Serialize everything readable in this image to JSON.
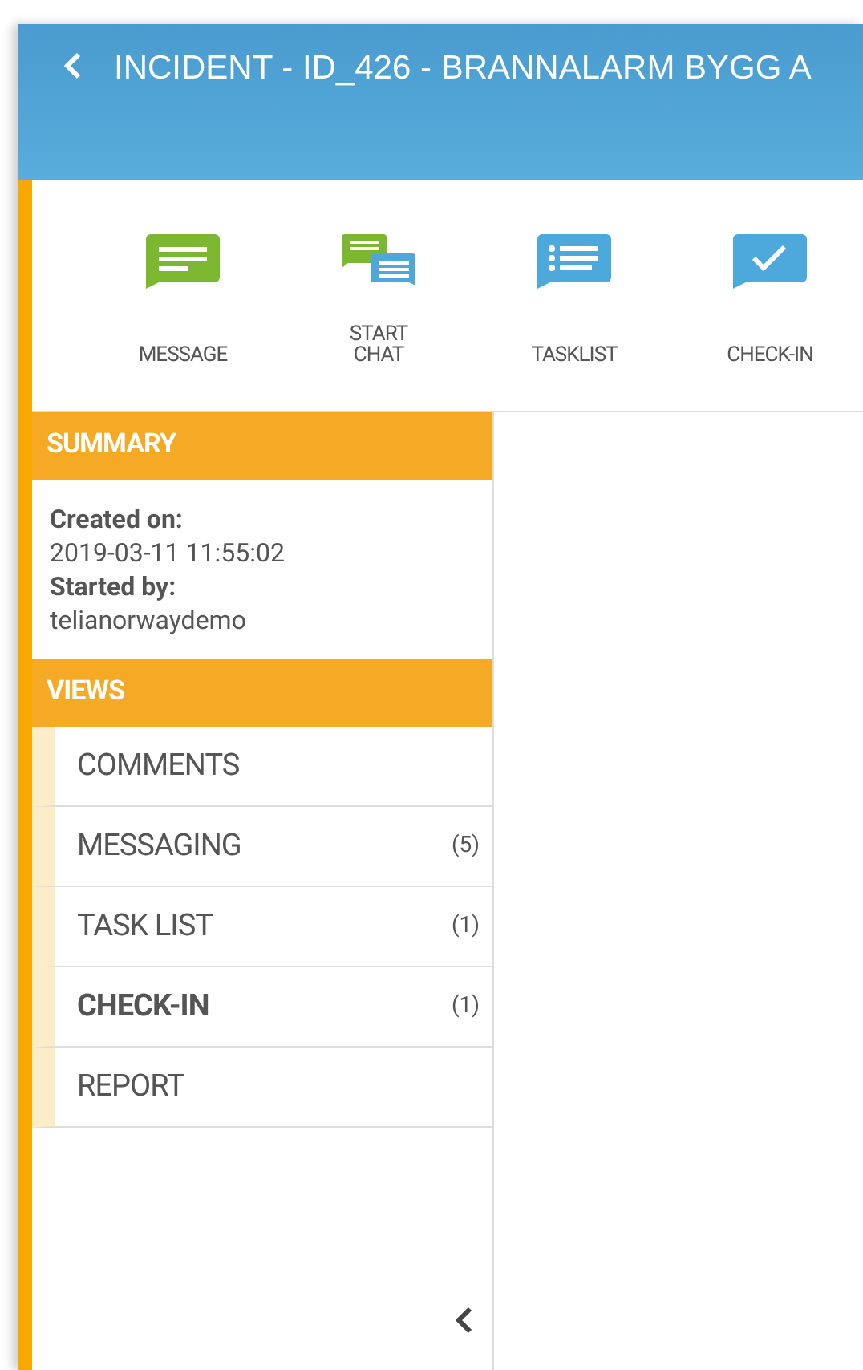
{
  "header": {
    "title": "INCIDENT - ID_426 - BRANNALARM BYGG A"
  },
  "actions": [
    {
      "kind": "message",
      "label": "MESSAGE"
    },
    {
      "kind": "chat",
      "label": "START\nCHAT"
    },
    {
      "kind": "tasklist",
      "label": "TASKLIST"
    },
    {
      "kind": "checkin",
      "label": "CHECK-IN"
    }
  ],
  "summary": {
    "title": "SUMMARY",
    "fields": [
      {
        "label": "Created on:",
        "value": "2019-03-11 11:55:02"
      },
      {
        "label": "Started by:",
        "value": "telianorwaydemo"
      }
    ]
  },
  "views": {
    "title": "VIEWS",
    "items": [
      {
        "label": "COMMENTS",
        "selected": false
      },
      {
        "label": "MESSAGING",
        "count": "(5)",
        "selected": false
      },
      {
        "label": "TASK LIST",
        "count": "(1)",
        "selected": false
      },
      {
        "label": "CHECK-IN",
        "count": "(1)",
        "selected": true
      },
      {
        "label": "REPORT",
        "selected": false
      }
    ]
  }
}
